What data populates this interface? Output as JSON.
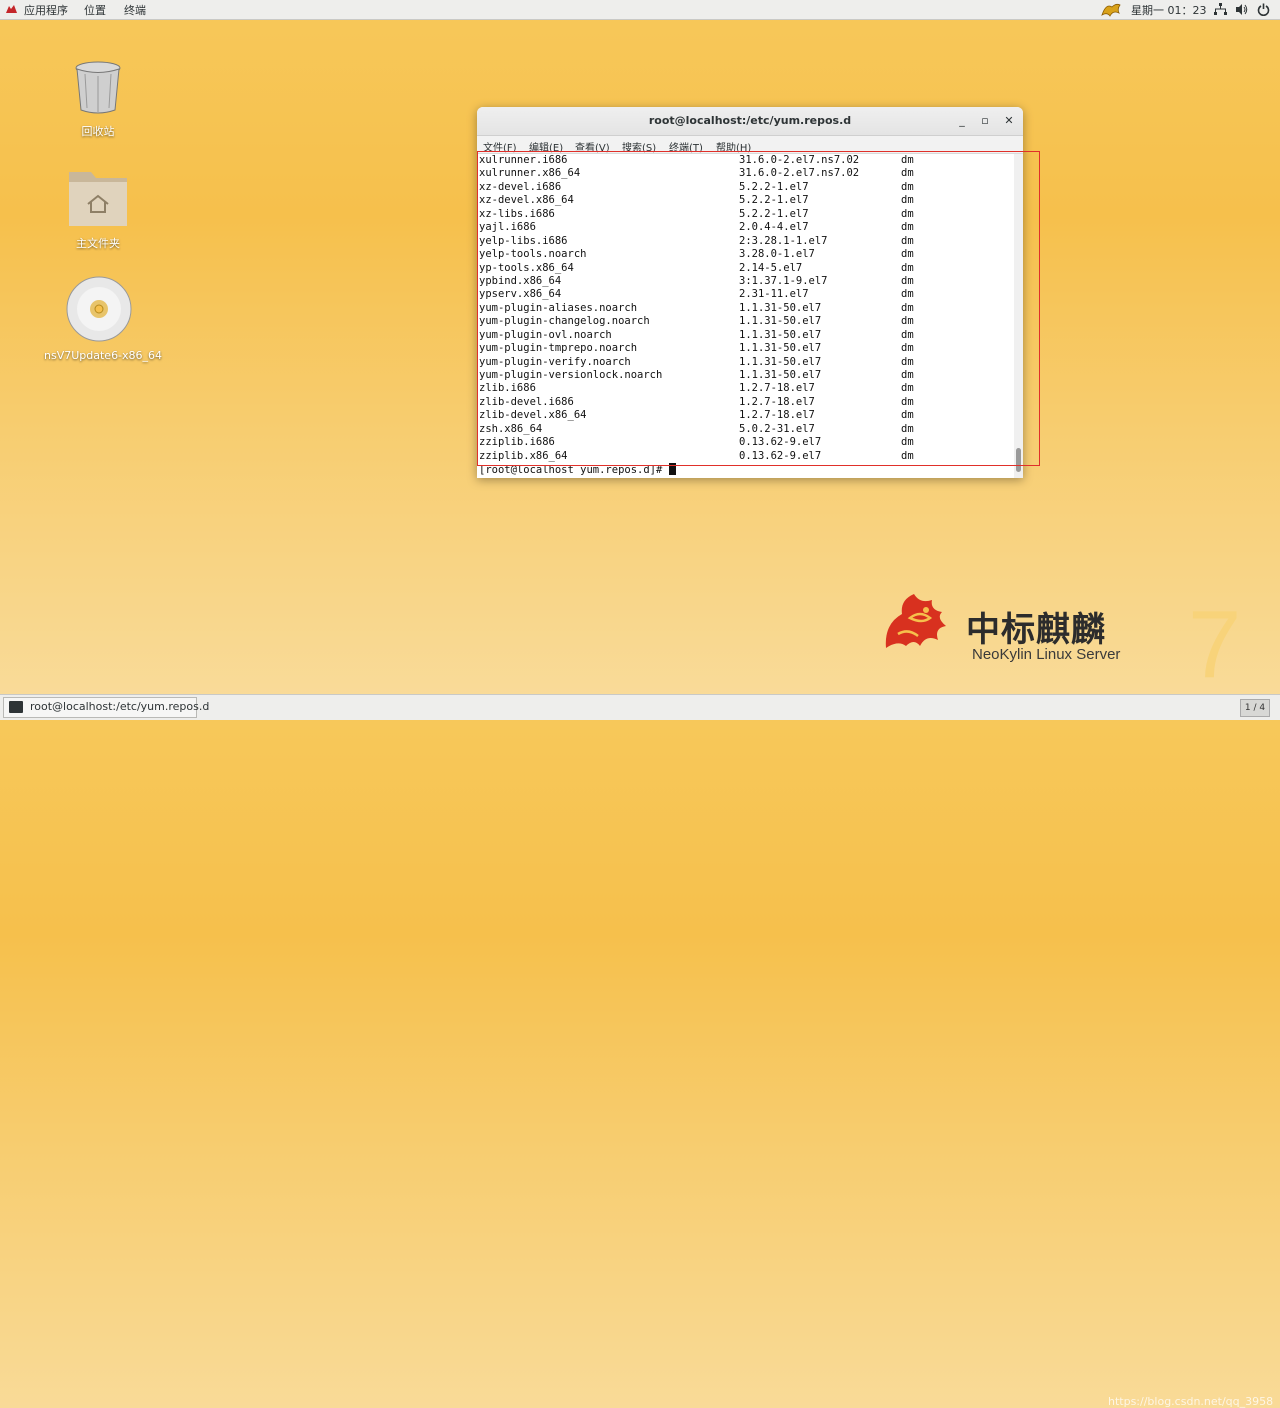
{
  "topbar": {
    "apps_label": "应用程序",
    "places_label": "位置",
    "terminal_label": "终端",
    "clock": "星期一 01：23"
  },
  "desktop": {
    "trash_label": "回收站",
    "home_label": "主文件夹",
    "disc_label": "nsV7Update6-x86_64"
  },
  "window": {
    "title": "root@localhost:/etc/yum.repos.d",
    "menu": [
      "文件(F)",
      "编辑(E)",
      "查看(V)",
      "搜索(S)",
      "终端(T)",
      "帮助(H)"
    ],
    "rows": [
      [
        "xulrunner.i686",
        "31.6.0-2.el7.ns7.02",
        "dm"
      ],
      [
        "xulrunner.x86_64",
        "31.6.0-2.el7.ns7.02",
        "dm"
      ],
      [
        "xz-devel.i686",
        "5.2.2-1.el7",
        "dm"
      ],
      [
        "xz-devel.x86_64",
        "5.2.2-1.el7",
        "dm"
      ],
      [
        "xz-libs.i686",
        "5.2.2-1.el7",
        "dm"
      ],
      [
        "yajl.i686",
        "2.0.4-4.el7",
        "dm"
      ],
      [
        "yelp-libs.i686",
        "2:3.28.1-1.el7",
        "dm"
      ],
      [
        "yelp-tools.noarch",
        "3.28.0-1.el7",
        "dm"
      ],
      [
        "yp-tools.x86_64",
        "2.14-5.el7",
        "dm"
      ],
      [
        "ypbind.x86_64",
        "3:1.37.1-9.el7",
        "dm"
      ],
      [
        "ypserv.x86_64",
        "2.31-11.el7",
        "dm"
      ],
      [
        "yum-plugin-aliases.noarch",
        "1.1.31-50.el7",
        "dm"
      ],
      [
        "yum-plugin-changelog.noarch",
        "1.1.31-50.el7",
        "dm"
      ],
      [
        "yum-plugin-ovl.noarch",
        "1.1.31-50.el7",
        "dm"
      ],
      [
        "yum-plugin-tmprepo.noarch",
        "1.1.31-50.el7",
        "dm"
      ],
      [
        "yum-plugin-verify.noarch",
        "1.1.31-50.el7",
        "dm"
      ],
      [
        "yum-plugin-versionlock.noarch",
        "1.1.31-50.el7",
        "dm"
      ],
      [
        "zlib.i686",
        "1.2.7-18.el7",
        "dm"
      ],
      [
        "zlib-devel.i686",
        "1.2.7-18.el7",
        "dm"
      ],
      [
        "zlib-devel.x86_64",
        "1.2.7-18.el7",
        "dm"
      ],
      [
        "zsh.x86_64",
        "5.0.2-31.el7",
        "dm"
      ],
      [
        "zziplib.i686",
        "0.13.62-9.el7",
        "dm"
      ],
      [
        "zziplib.x86_64",
        "0.13.62-9.el7",
        "dm"
      ]
    ],
    "prompt": "[root@localhost yum.repos.d]# "
  },
  "brand": {
    "chinese": "中标麒麟",
    "english": "NeoKylin Linux Server",
    "version": "7"
  },
  "taskbar": {
    "task_title": "root@localhost:/etc/yum.repos.d",
    "workspace": "1 / 4",
    "watermark": "https://blog.csdn.net/qq_3958"
  },
  "colors": {
    "highlight_box": "#e0302a",
    "desktop_bg": "#f6c04c"
  }
}
